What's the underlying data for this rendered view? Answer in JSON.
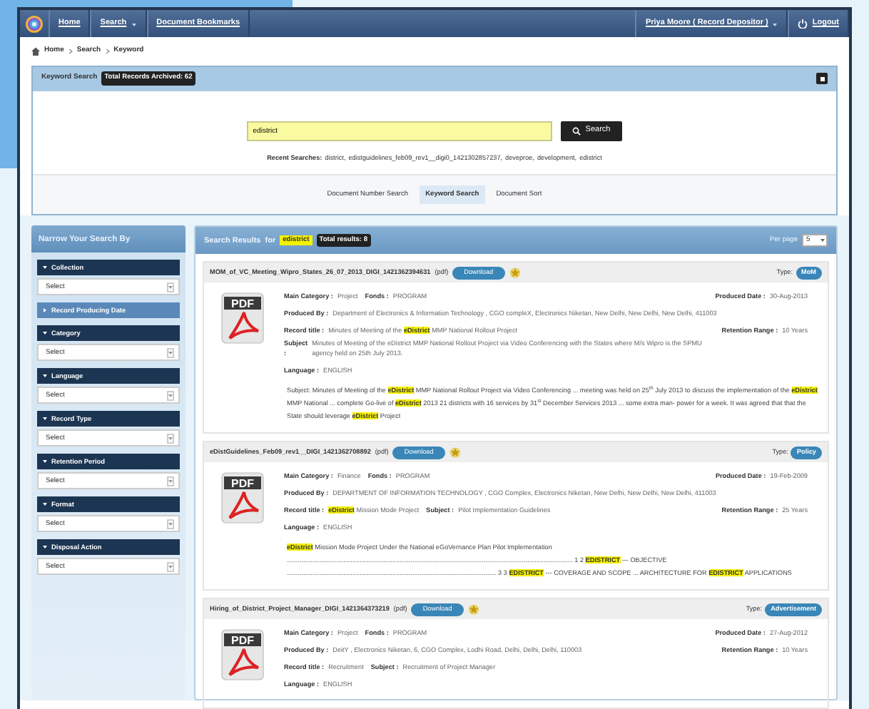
{
  "nav": {
    "items": [
      {
        "label": "Home",
        "dropdown": false
      },
      {
        "label": "Search",
        "dropdown": true
      },
      {
        "label": "Document Bookmarks",
        "dropdown": false
      }
    ],
    "user": "Priya Moore ( Record Depositor )",
    "logout": "Logout"
  },
  "breadcrumb": [
    "Home",
    "Search",
    "Keyword"
  ],
  "keyword_panel": {
    "title": "Keyword Search",
    "badge": "Total Records Archived: 62",
    "query": "edistrict",
    "search_button": "Search",
    "recent_label": "Recent Searches:",
    "recent": [
      "district,",
      "edistguidelines_feb09_rev1__digi0_1421302857237,",
      "deveproe,",
      "development,",
      "edistrict"
    ]
  },
  "search_tabs": [
    {
      "label": "Document Number Search",
      "selected": false
    },
    {
      "label": "Keyword Search",
      "selected": true
    },
    {
      "label": "Document Sort",
      "selected": false
    }
  ],
  "sidebar": {
    "title": "Narrow Your Search By",
    "filters": [
      {
        "label": "Collection",
        "expanded": true,
        "value": "Select"
      },
      {
        "label": "Record Producing Date",
        "expanded": false
      },
      {
        "label": "Category",
        "expanded": true,
        "value": "Select"
      },
      {
        "label": "Language",
        "expanded": true,
        "value": "Select"
      },
      {
        "label": "Record Type",
        "expanded": true,
        "value": "Select"
      },
      {
        "label": "Retention Period",
        "expanded": true,
        "value": "Select"
      },
      {
        "label": "Format",
        "expanded": true,
        "value": "Select"
      },
      {
        "label": "Disposal Action",
        "expanded": true,
        "value": "Select"
      }
    ]
  },
  "results": {
    "title": "Search Results",
    "for_label": "for",
    "query": "edistrict",
    "total": "Total results: 8",
    "per_page_label": "Per page",
    "per_page": "5",
    "items": [
      {
        "title": "MOM_of_VC_Meeting_Wipro_States_26_07_2013_DIGI_1421362394631",
        "ext": "(pdf)",
        "download": "Download",
        "type_label": "Type:",
        "type": "MoM",
        "icon_label": "PDF",
        "lines": [
          {
            "fields": [
              {
                "label": "Main Category :",
                "value": "Project"
              },
              {
                "label": "Fonds :",
                "value": "PROGRAM"
              }
            ],
            "aside": {
              "label": "Produced Date :",
              "value": "30-Aug-2013"
            }
          },
          {
            "fields": [
              {
                "label": "Produced By :",
                "value": "Department of Electronics & Information Technology , CGO compleX, Electronics Niketan, New Delhi, New Delhi, New Delhi, 411003"
              }
            ]
          },
          {
            "fields": [
              {
                "label": "Record title :",
                "value": "Minutes of Meeting of the **eDistrict** MMP National Rollout Project"
              },
              {
                "label": "Subject :",
                "value": "Minutes of Meeting of the eDistrict MMP National Rollout Project via Video Conferencing with the States where M/s Wipro is the SPMU agency held on 25th July 2013."
              }
            ],
            "aside": {
              "label": "Retention Range :",
              "value": "10 Years"
            }
          },
          {
            "fields": [
              {
                "label": "Language :",
                "value": "ENGLISH"
              }
            ]
          }
        ],
        "snippet": "Subject: Minutes of Meeting of the **eDistrict** MMP National Rollout Project via Video Conferencing ... meeting was held on 25$^{th}$ July 2013 to discuss the implementation of the **eDistrict** MMP National ... complete Go-live of **eDistrict** 2013 21 districts with 16 services by 31$^{st}$ December Services 2013 ... some extra man- power for a week. It was agreed that that the State should leverage **eDistrict** Project"
      },
      {
        "title": "eDistGuidelines_Feb09_rev1__DIGI_1421362708892",
        "ext": "(pdf)",
        "download": "Download",
        "type_label": "Type:",
        "type": "Policy",
        "icon_label": "PDF",
        "lines": [
          {
            "fields": [
              {
                "label": "Main Category :",
                "value": "Finance"
              },
              {
                "label": "Fonds :",
                "value": "PROGRAM"
              }
            ],
            "aside": {
              "label": "Produced Date :",
              "value": "19-Feb-2009"
            }
          },
          {
            "fields": [
              {
                "label": "Produced By :",
                "value": "DEPARTMENT OF INFORMATION TECHNOLOGY , CGO Complex, Electronics Niketan, New Delhi, New Delhi, New Delhi, 411003"
              }
            ]
          },
          {
            "fields": [
              {
                "label": "Record title :",
                "value": "**eDistrict** Mission Mode Project"
              },
              {
                "label": "Subject :",
                "value": "Pilot Implementation Guidelines"
              }
            ],
            "aside": {
              "label": "Retention Range :",
              "value": "25 Years"
            }
          },
          {
            "fields": [
              {
                "label": "Language :",
                "value": "ENGLISH"
              }
            ]
          }
        ],
        "snippet": "**eDistrict** Mission Mode Project Under the National eGoVernance Plan Pilot Implementation ............................................................................................................................................................. 1 2 **EDISTRICT** --- OBJECTIVE ................................................................................................................... 3 3 **EDISTRICT** --- COVERAGE AND SCOPE ... ARCHITECTURE FOR **EDISTRICT** APPLICATIONS"
      },
      {
        "title": "Hiring_of_District_Project_Manager_DIGI_1421364373219",
        "ext": "(pdf)",
        "download": "Download",
        "type_label": "Type:",
        "type": "Advertisement",
        "icon_label": "PDF",
        "lines": [
          {
            "fields": [
              {
                "label": "Main Category :",
                "value": "Project"
              },
              {
                "label": "Fonds :",
                "value": "PROGRAM"
              }
            ],
            "aside": {
              "label": "Produced Date :",
              "value": "27-Aug-2012"
            }
          },
          {
            "fields": [
              {
                "label": "Produced By :",
                "value": "DeitY , Electronics Niketan, 6, CGO Complex, Lodhi Road, Delhi, Delhi, Delhi, 110003"
              }
            ],
            "aside": {
              "label": "Retention Range :",
              "value": "10 Years"
            }
          },
          {
            "fields": [
              {
                "label": "Record title :",
                "value": "Recruitment"
              },
              {
                "label": "Subject :",
                "value": "Recruitment of Project Manager"
              }
            ]
          },
          {
            "fields": [
              {
                "label": "Language :",
                "value": "ENGLISH"
              }
            ]
          }
        ]
      }
    ]
  }
}
